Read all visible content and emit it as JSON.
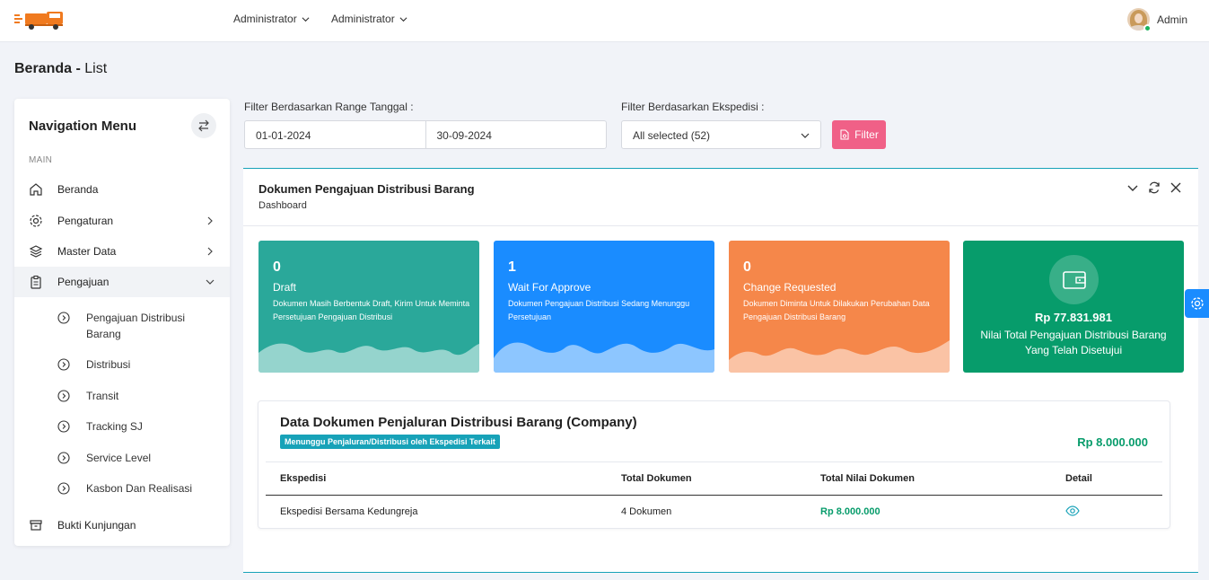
{
  "colors": {
    "teal": "#2aa89a",
    "blue": "#1a8cff",
    "orange": "#f5874a",
    "green": "#079c6b",
    "pink": "#f06087",
    "info": "#17a2b8"
  },
  "topbar": {
    "menus": [
      {
        "label": "Administrator"
      },
      {
        "label": "Administrator"
      }
    ],
    "user": {
      "name": "Admin"
    }
  },
  "page": {
    "title_bold": "Beranda -",
    "title_rest": " List"
  },
  "sidebar": {
    "title": "Navigation Menu",
    "section": "MAIN",
    "items": [
      {
        "label": "Beranda",
        "icon": "home-icon"
      },
      {
        "label": "Pengaturan",
        "icon": "gear-icon"
      },
      {
        "label": "Master Data",
        "icon": "layers-icon"
      },
      {
        "label": "Pengajuan",
        "icon": "clipboard-icon"
      }
    ],
    "subitems": [
      {
        "label": "Pengajuan Distribusi Barang"
      },
      {
        "label": "Distribusi"
      },
      {
        "label": "Transit"
      },
      {
        "label": "Tracking SJ"
      },
      {
        "label": "Service Level"
      },
      {
        "label": "Kasbon Dan Realisasi"
      }
    ],
    "last": {
      "label": "Bukti Kunjungan",
      "icon": "archive-icon"
    }
  },
  "filters": {
    "date_label": "Filter Berdasarkan Range Tanggal :",
    "date_from": "01-01-2024",
    "date_to": "30-09-2024",
    "ekspedisi_label": "Filter Berdasarkan Ekspedisi :",
    "ekspedisi_value": "All selected (52)",
    "button": "Filter"
  },
  "panel": {
    "title": "Dokumen Pengajuan Distribusi Barang",
    "subtitle": "Dashboard",
    "cards": [
      {
        "count": "0",
        "label": "Draft",
        "desc": "Dokumen Masih Berbentuk Draft, Kirim Untuk Meminta Persetujuan Pengajuan Distribusi",
        "color": "#2aa89a"
      },
      {
        "count": "1",
        "label": "Wait For Approve",
        "desc": "Dokumen Pengajuan Distribusi Sedang Menunggu Persetujuan",
        "color": "#1a8cff"
      },
      {
        "count": "0",
        "label": "Change Requested",
        "desc": "Dokumen Diminta Untuk Dilakukan Perubahan Data Pengajuan Distribusi Barang",
        "color": "#f5874a"
      }
    ],
    "total_card": {
      "amount": "Rp 77.831.981",
      "label": "Nilai Total Pengajuan Distribusi Barang Yang Telah Disetujui"
    },
    "table_card": {
      "title": "Data Dokumen Penjaluran Distribusi Barang (Company)",
      "badge": "Menunggu Penjaluran/Distribusi oleh Ekspedisi Terkait",
      "total": "Rp 8.000.000",
      "columns": [
        "Ekspedisi",
        "Total Dokumen",
        "Total Nilai Dokumen",
        "Detail"
      ],
      "rows": [
        {
          "ekspedisi": "Ekspedisi Bersama Kedungreja",
          "total_dokumen": "4 Dokumen",
          "total_nilai": "Rp 8.000.000"
        }
      ]
    }
  }
}
